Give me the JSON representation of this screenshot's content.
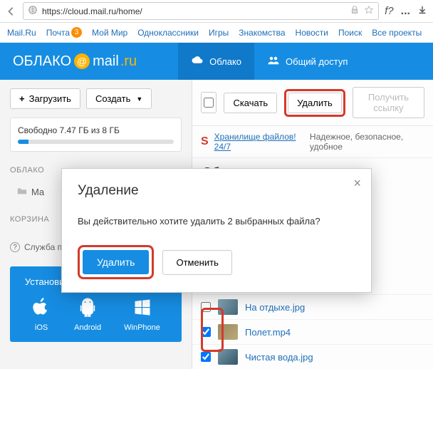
{
  "browser": {
    "url": "https://cloud.mail.ru/home/",
    "fquestion": "f?",
    "ellipsis": "..."
  },
  "topnav": {
    "items": [
      "Mail.Ru",
      "Почта",
      "Мой Мир",
      "Одноклассники",
      "Игры",
      "Знакомства",
      "Новости",
      "Поиск",
      "Все проекты"
    ],
    "mail_badge": "3"
  },
  "header": {
    "logo_text1": "ОБЛАКО",
    "logo_at": "@",
    "logo_mail": "mail",
    "logo_ru": ".ru",
    "tab_cloud": "Облако",
    "tab_shared": "Общий доступ"
  },
  "sidebar": {
    "upload": "Загрузить",
    "create": "Создать",
    "storage": "Свободно 7.47 ГБ из 8 ГБ",
    "section_cloud": "ОБЛАКО",
    "folder_ma": "Ma",
    "section_trash": "КОРЗИНА",
    "support": "Служба поддержки",
    "promo_title": "Установите Облако на смартфон",
    "ios": "iOS",
    "android": "Android",
    "winphone": "WinPhone"
  },
  "toolbar": {
    "download": "Скачать",
    "delete": "Удалить",
    "getlink": "Получить ссылку"
  },
  "promo_strip": {
    "s": "S",
    "link": "Хранилище файлов! 24/7",
    "rest": "Надежное, безопасное, удобное"
  },
  "breadcrumb": "Облако",
  "files": [
    {
      "name": "На отдыхе.jpg",
      "checked": false
    },
    {
      "name": "Полет.mp4",
      "checked": true
    },
    {
      "name": "Чистая вода.jpg",
      "checked": true
    }
  ],
  "modal": {
    "title": "Удаление",
    "text": "Вы действительно хотите удалить 2 выбранных файла?",
    "confirm": "Удалить",
    "cancel": "Отменить",
    "close": "×"
  }
}
